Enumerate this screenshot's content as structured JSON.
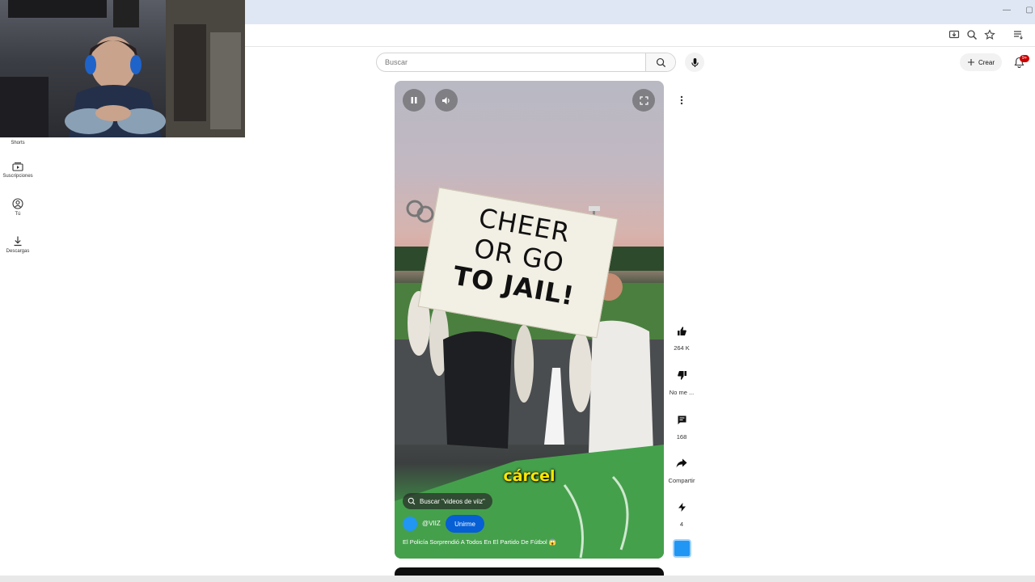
{
  "search": {
    "placeholder": "Buscar"
  },
  "header": {
    "create_label": "Crear",
    "notification_badge": "9+"
  },
  "sidebar": {
    "items": [
      {
        "label": "Shorts",
        "icon": "shorts-icon"
      },
      {
        "label": "Suscripciones",
        "icon": "subscriptions-icon"
      },
      {
        "label": "Tú",
        "icon": "account-icon"
      },
      {
        "label": "Descargas",
        "icon": "download-icon"
      }
    ]
  },
  "video": {
    "sign_text": [
      "CHEER",
      "OR GO",
      "TO JAIL!"
    ],
    "subtitle": "cárcel",
    "search_chip": "Buscar \"videos de viiz\"",
    "channel_name": "@VIIZ",
    "join_label": "Unirme",
    "title": "El Policía Sorprendió A Todos En El Partido De Fútbol 😱"
  },
  "actions": {
    "like_count": "264 K",
    "dislike_label": "No me ...",
    "comment_count": "168",
    "share_label": "Compartir",
    "remix_count": "4"
  },
  "colors": {
    "join_button": "#065fd4",
    "subtitle": "#ffe600",
    "badge": "#cc0000"
  }
}
